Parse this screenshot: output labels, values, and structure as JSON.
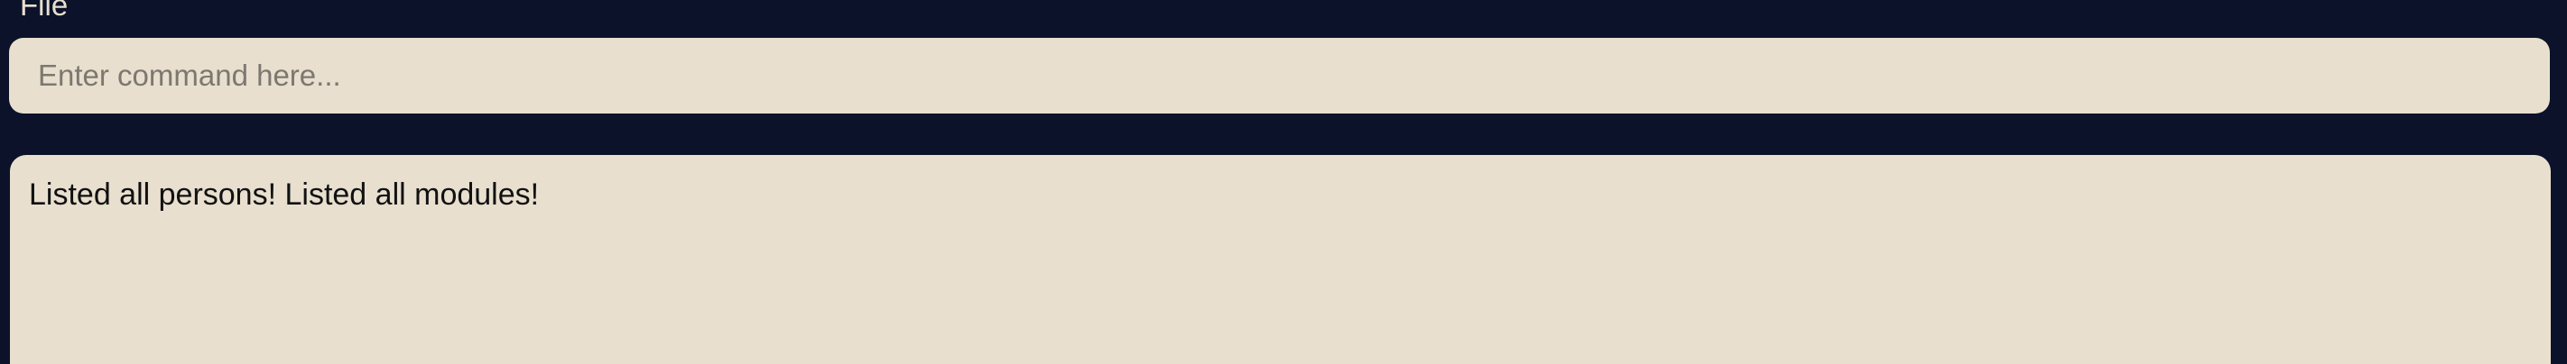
{
  "menubar": {
    "items": [
      {
        "label": "File"
      }
    ]
  },
  "command": {
    "placeholder": "Enter command here...",
    "value": ""
  },
  "result": {
    "text": "Listed all persons! Listed all modules!"
  },
  "colors": {
    "background": "#0b1229",
    "panel": "#e8dfcf",
    "menu_text": "#e8dfcf",
    "text": "#111111",
    "placeholder": "#7d786f"
  }
}
